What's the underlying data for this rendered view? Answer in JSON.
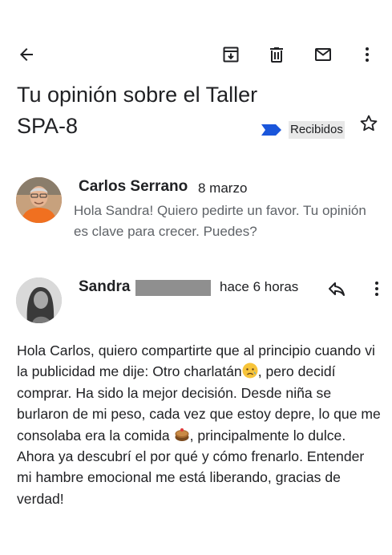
{
  "toolbar": {
    "back_icon": "arrow-back-icon",
    "archive_icon": "archive-icon",
    "delete_icon": "trash-icon",
    "mark_unread_icon": "mail-icon",
    "more_icon": "more-vert-icon"
  },
  "email": {
    "subject": "Tu opinión sobre el Taller SPA-8",
    "label": "Recibidos",
    "label_color": "#1a56db"
  },
  "messages": [
    {
      "sender": "Carlos Serrano",
      "date": "8 marzo",
      "snippet": "Hola Sandra! Quiero pedirte un favor. Tu opinión es clave para crecer. Puedes?"
    },
    {
      "sender": "Sandra",
      "date": "hace 6 horas",
      "body_parts": [
        "Hola Carlos, quiero compartirte que  al principio cuando vi la publicidad me dije: Otro charlatán",
        ", pero decidí comprar. Ha sido la mejor decisión. Desde niña se burlaron de mi peso, cada vez que estoy depre, lo que me consolaba era la comida ",
        ", principalmente lo dulce. Ahora ya descubrí el por qué y cómo frenarlo. Entender mi hambre emocional me está liberando, gracias de verdad!"
      ]
    }
  ]
}
